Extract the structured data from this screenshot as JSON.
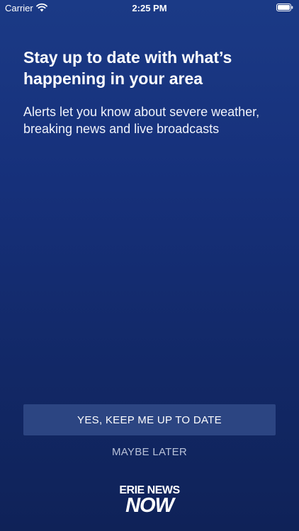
{
  "status_bar": {
    "carrier": "Carrier",
    "time": "2:25 PM"
  },
  "onboarding": {
    "title": "Stay up to date with what’s happening in your area",
    "subtitle": "Alerts let you know about severe weather, breaking news and live broadcasts",
    "primary_button_label": "YES, KEEP ME UP TO DATE",
    "secondary_button_label": "MAYBE LATER"
  },
  "logo": {
    "line1": "ERIE NEWS",
    "line2": "NOW"
  },
  "colors": {
    "background_top": "#1b3a86",
    "background_bottom": "#0f2258",
    "primary_button": "#2c4582",
    "secondary_text": "#b8c2d9"
  },
  "icons": {
    "signal": "wifi-icon",
    "battery": "battery-icon"
  }
}
